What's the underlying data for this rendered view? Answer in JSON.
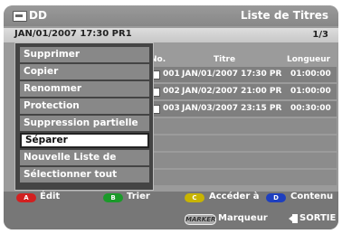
{
  "header": {
    "source": "DD",
    "screen_title": "Liste de Titres",
    "current_title": "JAN/01/2007 17:30 PR1",
    "page": "1/3"
  },
  "table": {
    "columns": [
      "No.",
      "Titre",
      "Longueur"
    ],
    "rows": [
      {
        "no": "001",
        "title": "JAN/01/2007 17:30 PR",
        "length": "01:00:00"
      },
      {
        "no": "002",
        "title": "JAN/02/2007 21:00 PR",
        "length": "01:00:00"
      },
      {
        "no": "003",
        "title": "JAN/03/2007 23:15 PR",
        "length": "00:30:00"
      }
    ]
  },
  "menu": {
    "items": [
      "Supprimer",
      "Copier",
      "Renommer",
      "Protection",
      "Suppression partielle",
      "Séparer",
      "Nouvelle Liste de Lecture",
      "Sélectionner tout"
    ],
    "selected": "Séparer"
  },
  "buttons": {
    "a": {
      "key": "A",
      "label": "Édit",
      "color": "#d22020"
    },
    "b": {
      "key": "B",
      "label": "Trier",
      "color": "#1b9a2a"
    },
    "c": {
      "key": "C",
      "label": "Accéder à",
      "color": "#c8b400"
    },
    "d": {
      "key": "D",
      "label": "Contenu",
      "color": "#1e3fbf"
    },
    "marker": {
      "key": "MARKER",
      "label": "Marqueur"
    },
    "exit": {
      "label": "SORTIE"
    }
  }
}
